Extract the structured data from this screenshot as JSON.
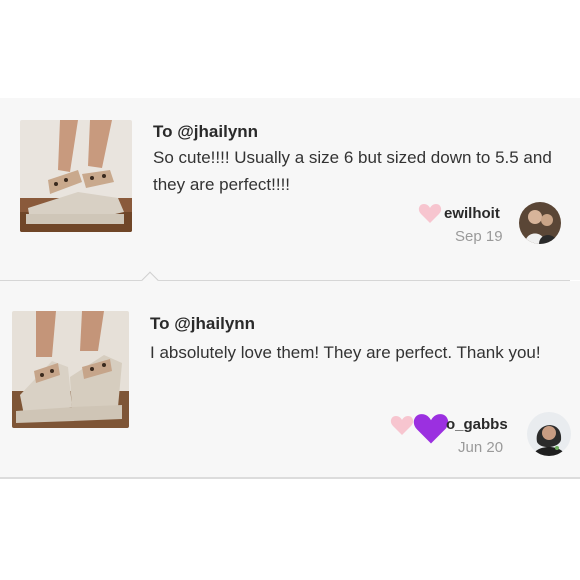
{
  "reviews": [
    {
      "recipient": "To @jhailynn",
      "message": "So cute!!!! Usually a size 6 but sized down to 5.5 and they are perfect!!!!",
      "username": "ewilhoit",
      "date": "Sep 19"
    },
    {
      "recipient": "To @jhailynn",
      "message": "I absolutely love them! They are perfect. Thank you!",
      "username": "o_gabbs",
      "date": "Jun 20"
    }
  ],
  "colors": {
    "heart_pink": "#f7c5cf",
    "heart_purple": "#9b30e0",
    "card_bg": "#f7f7f7",
    "text_muted": "#9a9a9a"
  },
  "icons": [
    "heart-icon",
    "purple-heart-icon"
  ]
}
